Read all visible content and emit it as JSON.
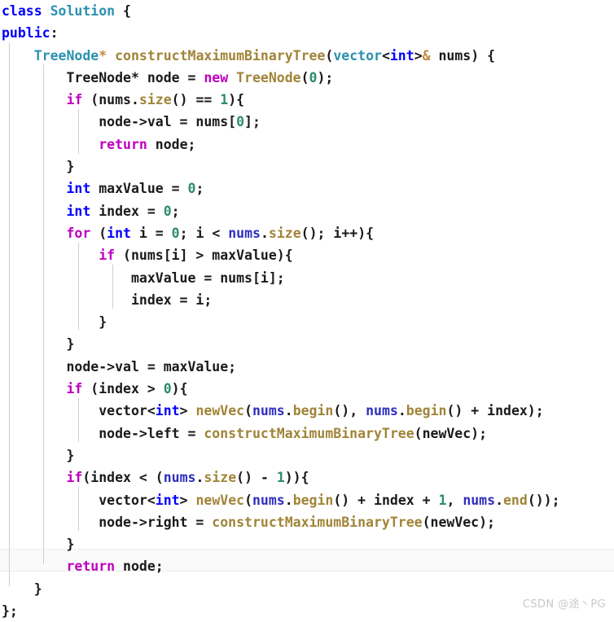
{
  "editor": {
    "language": "cpp",
    "background_color": "#ffffff",
    "indent_guide_color": "#cfcfcf",
    "highlighted_line_number": 25
  },
  "theme": {
    "keyword": "#0000ff",
    "control_keyword": "#bf00bf",
    "type": "#2b91af",
    "function": "#a08438",
    "number": "#2e8b6e",
    "object": "#2f2fbf",
    "plain": "#1a1a1a",
    "pointer_decorator": "#c08b3c",
    "watermark": "#c9c9c9"
  },
  "code": {
    "lines": [
      "class Solution {",
      "public:",
      "    TreeNode* constructMaximumBinaryTree(vector<int>& nums) {",
      "        TreeNode* node = new TreeNode(0);",
      "        if (nums.size() == 1){",
      "            node->val = nums[0];",
      "            return node;",
      "        }",
      "        int maxValue = 0;",
      "        int index = 0;",
      "        for (int i = 0; i < nums.size(); i++){",
      "            if (nums[i] > maxValue){",
      "                maxValue = nums[i];",
      "                index = i;",
      "            }",
      "        }",
      "        node->val = maxValue;",
      "        if (index > 0){",
      "            vector<int> newVec(nums.begin(), nums.begin() + index);",
      "            node->left = constructMaximumBinaryTree(newVec);",
      "        }",
      "        if(index < (nums.size() - 1)){",
      "            vector<int> newVec(nums.begin() + index + 1, nums.end());",
      "            node->right = constructMaximumBinaryTree(newVec);",
      "        }",
      "        return node;",
      "    }",
      "};"
    ]
  },
  "watermark": {
    "text": "CSDN @途丶PG"
  }
}
